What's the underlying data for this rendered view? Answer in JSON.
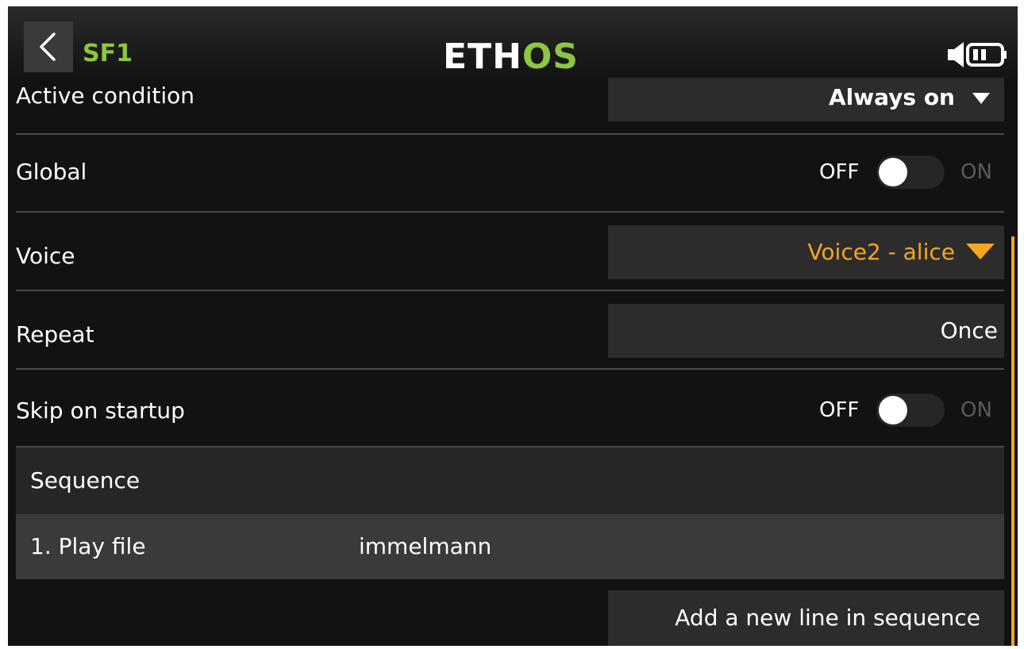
{
  "header": {
    "title": "SF1",
    "logo_main": "ETH",
    "logo_accent": "OS",
    "back_icon": "chevron-left-icon",
    "volume_icon": "speaker-icon",
    "battery_icon": "battery-icon"
  },
  "colors": {
    "accent_green": "#8dc63f",
    "accent_orange": "#f5a623"
  },
  "rows": {
    "active_condition": {
      "label": "Active condition",
      "value": "Always on"
    },
    "global": {
      "label": "Global",
      "off_label": "OFF",
      "on_label": "ON",
      "state": "off"
    },
    "voice": {
      "label": "Voice",
      "value": "Voice2 - alice"
    },
    "repeat": {
      "label": "Repeat",
      "value": "Once"
    },
    "skip_on_startup": {
      "label": "Skip on startup",
      "off_label": "OFF",
      "on_label": "ON",
      "state": "off"
    }
  },
  "sequence": {
    "header": "Sequence",
    "items": [
      {
        "action": "1. Play file",
        "value": "immelmann"
      }
    ],
    "add_button": "Add a new line in sequence"
  }
}
